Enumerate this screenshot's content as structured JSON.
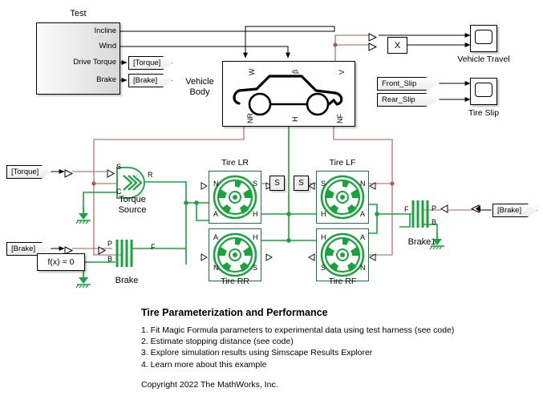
{
  "model": {
    "title": "Tire Parameterization and Performance",
    "copyright": "Copyright 2022 The MathWorks, Inc.",
    "steps": [
      "1. Fit Magic Formula parameters to experimental data using test harness (see code)",
      "2. Estimate stopping distance (see code)",
      "3. Explore simulation results using Simscape Results Explorer",
      "4. Learn more about this example"
    ]
  },
  "colors": {
    "physical_wire": "#19a33c",
    "signal_wire": "#000000",
    "mech_wire": "#a85b5b",
    "tire_border": "#1a7a3c",
    "block_border": "#000000"
  },
  "test_block": {
    "label": "Test",
    "ports": [
      "Incline",
      "Wind",
      "Drive Torque",
      "Brake"
    ]
  },
  "vehicle_body": {
    "label_line1": "Vehicle",
    "label_line2": "Body",
    "top_ports": [
      "W",
      "β",
      "V"
    ],
    "bottom_ports": [
      "NR",
      "H",
      "NF"
    ]
  },
  "tags": {
    "torque_goto": "[Torque]",
    "brake_goto": "[Brake]",
    "torque_from": "[Torque]",
    "brake_from": "[Brake]",
    "front_slip": "Front_Slip",
    "rear_slip": "Rear_Slip"
  },
  "scopes": {
    "vehicle_travel": "Vehicle Travel",
    "tire_slip": "Tire Slip"
  },
  "blocks": {
    "x_gain": "X",
    "solver": "f(x) = 0",
    "sensor_lr": "S",
    "sensor_lf": "S",
    "torque_source_line1": "Torque",
    "torque_source_line2": "Source",
    "torque_source_ports": [
      "S",
      "C",
      "R"
    ],
    "brake": "Brake",
    "brake1": "Brake1",
    "brake_ports": [
      "P",
      "B",
      "F"
    ]
  },
  "tires": [
    {
      "name": "Tire LR",
      "ports": {
        "tl": "N",
        "tr": "S",
        "bl": "A",
        "br": "H"
      }
    },
    {
      "name": "Tire LF",
      "ports": {
        "tl": "S",
        "tr": "N",
        "bl": "H",
        "br": "A"
      }
    },
    {
      "name": "Tire RR",
      "ports": {
        "tl": "A",
        "tr": "H",
        "bl": "N",
        "br": "S"
      }
    },
    {
      "name": "Tire RF",
      "ports": {
        "tl": "H",
        "tr": "A",
        "bl": "S",
        "br": "N"
      }
    }
  ]
}
